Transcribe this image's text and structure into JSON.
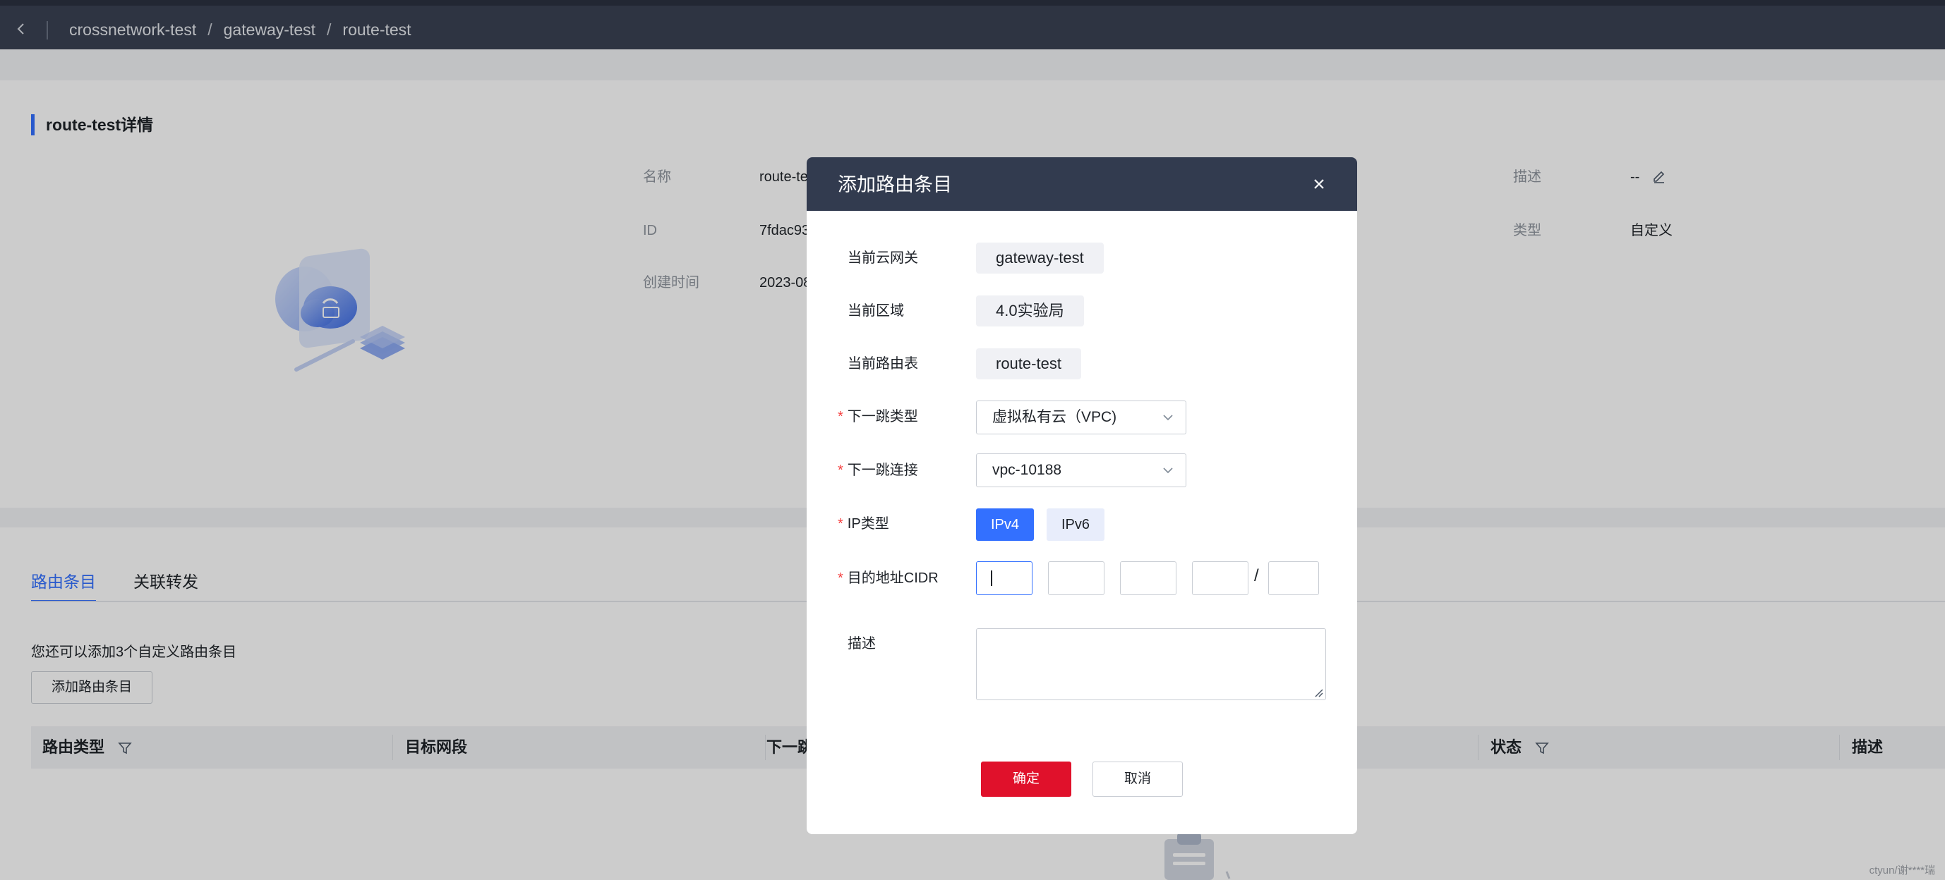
{
  "breadcrumb": {
    "items": [
      "crossnetwork-test",
      "gateway-test",
      "route-test"
    ],
    "separator": "/"
  },
  "detail": {
    "title": "route-test详情",
    "fields": {
      "name_label": "名称",
      "name_value": "route-te",
      "id_label": "ID",
      "id_value": "7fdac93",
      "created_label": "创建时间",
      "created_value": "2023-08",
      "desc_label": "描述",
      "desc_value": "--",
      "type_label": "类型",
      "type_value": "自定义"
    }
  },
  "tabs": [
    {
      "label": "路由条目",
      "active": true
    },
    {
      "label": "关联转发",
      "active": false
    }
  ],
  "list": {
    "tip": "您还可以添加3个自定义路由条目",
    "add_button": "添加路由条目",
    "columns": [
      "路由类型",
      "目标网段",
      "下一跳",
      "状态",
      "描述"
    ]
  },
  "watermark": "ctyun/谢****瑞",
  "modal": {
    "title": "添加路由条目",
    "close_icon": "close-icon",
    "fields": {
      "gateway_label": "当前云网关",
      "gateway_value": "gateway-test",
      "region_label": "当前区域",
      "region_value": "4.0实验局",
      "table_label": "当前路由表",
      "table_value": "route-test",
      "required_mark": "*",
      "next_hop_type_label": "下一跳类型",
      "next_hop_type_value": "虚拟私有云（VPC)",
      "next_hop_conn_label": "下一跳连接",
      "next_hop_conn_value": "vpc-10188",
      "ip_type_label": "IP类型",
      "ipv4": "IPv4",
      "ipv6": "IPv6",
      "cidr_label": "目的地址CIDR",
      "cidr_values": [
        "",
        "",
        "",
        "",
        ""
      ],
      "cidr_slash": "/",
      "desc_label": "描述",
      "desc_value": ""
    },
    "ok_button": "确定",
    "cancel_button": "取消"
  },
  "colors": {
    "accent": "#3370ff",
    "confirm": "#e0112b",
    "header_bg": "#323b4f",
    "topbar_bg": "#3a4253"
  }
}
